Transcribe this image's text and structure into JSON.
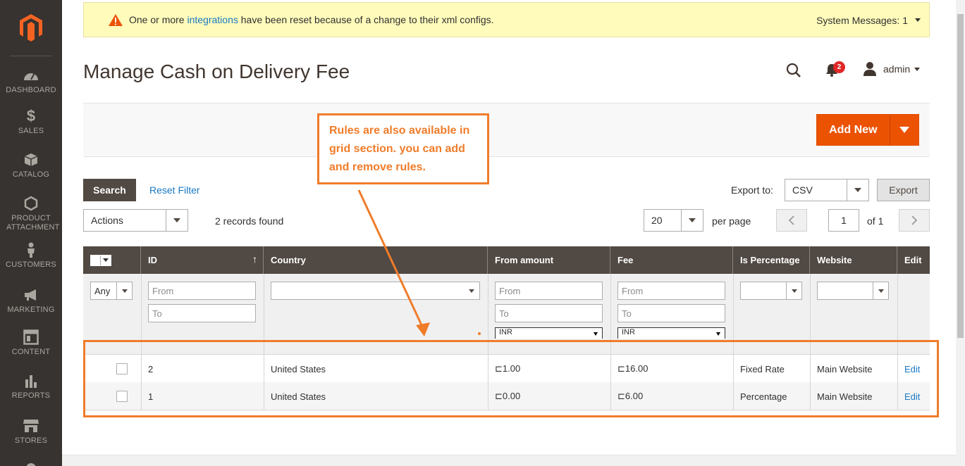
{
  "nav": [
    {
      "label": "Dashboard",
      "icon": "dashboard-icon"
    },
    {
      "label": "Sales",
      "icon": "dollar-icon"
    },
    {
      "label": "Catalog",
      "icon": "cube-icon"
    },
    {
      "label": "Product Attachment",
      "icon": "hexagon-icon"
    },
    {
      "label": "Customers",
      "icon": "person-icon"
    },
    {
      "label": "Marketing",
      "icon": "megaphone-icon"
    },
    {
      "label": "Content",
      "icon": "layout-icon"
    },
    {
      "label": "Reports",
      "icon": "bar-chart-icon"
    },
    {
      "label": "Stores",
      "icon": "store-icon"
    }
  ],
  "sysmsg": {
    "before": "One or more ",
    "link": "integrations",
    "after": " have been reset because of a change to their xml configs.",
    "count_label": "System Messages: 1"
  },
  "header": {
    "title": "Manage Cash on Delivery Fee",
    "notifications": "2",
    "user": "admin"
  },
  "actions": {
    "add_new": "Add New"
  },
  "callout": "Rules are also available in grid section. you can add and remove rules.",
  "toolbar": {
    "search": "Search",
    "reset_filter": "Reset Filter",
    "export_to": "Export to:",
    "export_format": "CSV",
    "export": "Export",
    "mass_actions": "Actions",
    "records_found": "2 records found",
    "per_page_value": "20",
    "per_page_label": "per page",
    "page": "1",
    "of_pages": "of 1"
  },
  "grid": {
    "columns": [
      "ID",
      "Country",
      "From amount",
      "Fee",
      "Is Percentage",
      "Website",
      "Edit"
    ],
    "filters": {
      "any": "Any",
      "from": "From",
      "to": "To",
      "currency": "INR"
    },
    "rows": [
      {
        "id": "2",
        "country": "United States",
        "from_amount": "⊏1.00",
        "fee": "⊏16.00",
        "is_percentage": "Fixed Rate",
        "website": "Main Website",
        "edit": "Edit"
      },
      {
        "id": "1",
        "country": "United States",
        "from_amount": "⊏0.00",
        "fee": "⊏6.00",
        "is_percentage": "Percentage",
        "website": "Main Website",
        "edit": "Edit"
      }
    ]
  },
  "colors": {
    "accent": "#eb5202",
    "annotation": "#f07c2a",
    "sidebar": "#373330",
    "grid_header": "#514943",
    "link": "#1979c3"
  }
}
